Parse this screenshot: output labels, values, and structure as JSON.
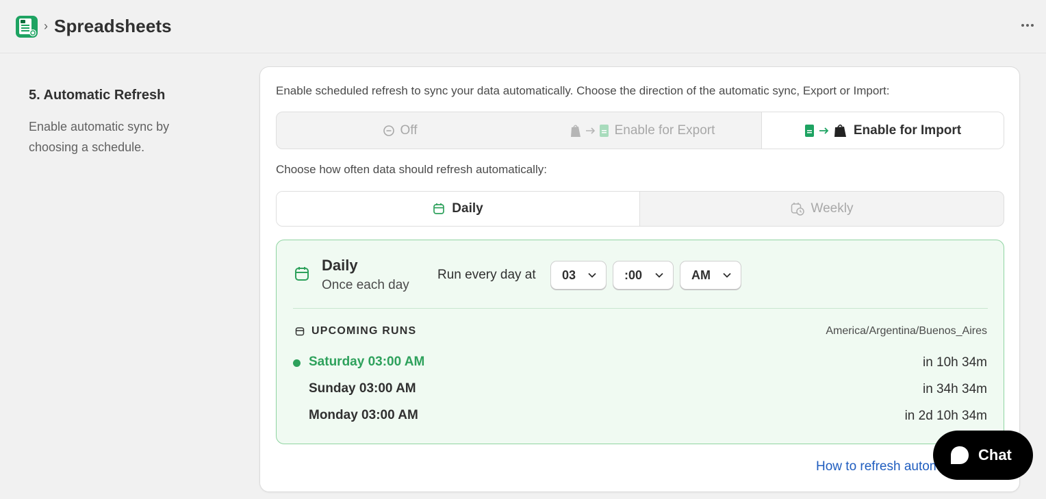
{
  "header": {
    "title": "Spreadsheets",
    "separator": "›"
  },
  "section": {
    "title": "5. Automatic Refresh",
    "description": "Enable automatic sync by choosing a schedule."
  },
  "card": {
    "intro": "Enable scheduled refresh to sync your data automatically. Choose the direction of the automatic sync, Export or Import:",
    "direction_options": [
      {
        "label": "Off",
        "selected": false
      },
      {
        "label": "Enable for Export",
        "selected": false
      },
      {
        "label": "Enable for Import",
        "selected": true
      }
    ],
    "frequency_label": "Choose how often data should refresh automatically:",
    "frequency_options": [
      {
        "label": "Daily",
        "selected": true
      },
      {
        "label": "Weekly",
        "selected": false
      }
    ],
    "schedule": {
      "title": "Daily",
      "subtitle": "Once each day",
      "run_label": "Run every day at",
      "hour": "03",
      "minute": ":00",
      "ampm": "AM",
      "upcoming_label": "UPCOMING RUNS",
      "timezone": "America/Argentina/Buenos_Aires",
      "runs": [
        {
          "when": "Saturday 03:00 AM",
          "eta": "in 10h 34m",
          "next": true
        },
        {
          "when": "Sunday 03:00 AM",
          "eta": "in 34h 34m",
          "next": false
        },
        {
          "when": "Monday 03:00 AM",
          "eta": "in 2d 10h 34m",
          "next": false
        }
      ]
    },
    "help_link": "How to refresh automatically"
  },
  "chat": {
    "label": "Chat"
  },
  "colors": {
    "accent_green": "#2ea15c",
    "panel_bg": "#f0faf2",
    "link_blue": "#1f5dbf"
  }
}
